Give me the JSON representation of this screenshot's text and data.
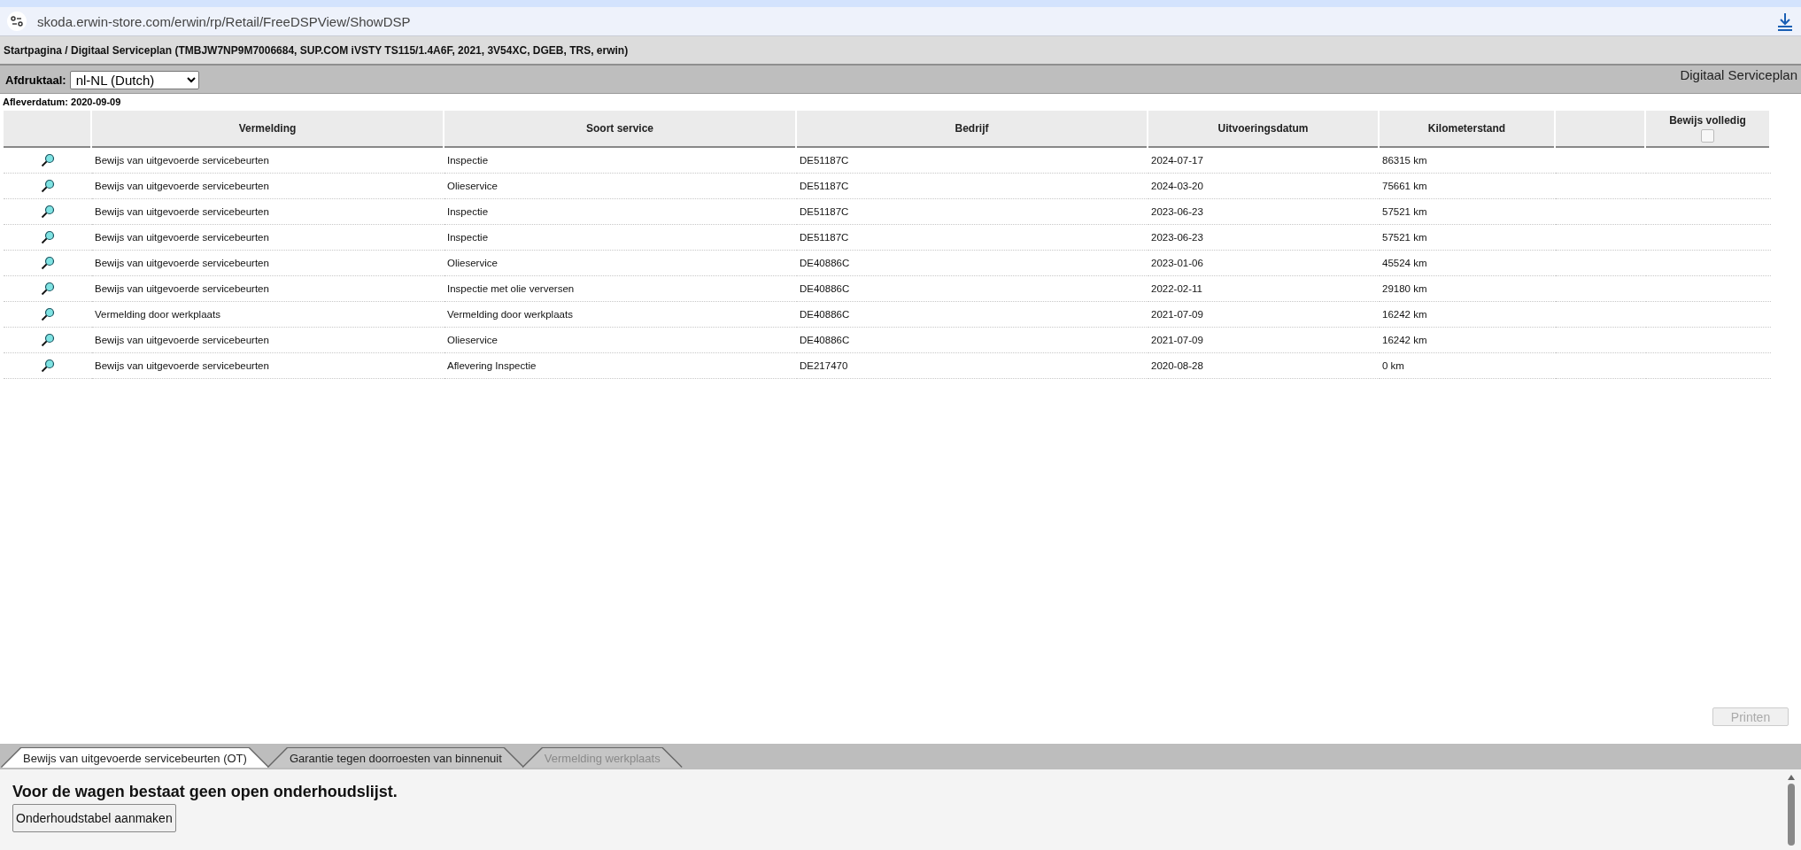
{
  "browser": {
    "url": "skoda.erwin-store.com/erwin/rp/Retail/FreeDSPView/ShowDSP"
  },
  "breadcrumb": "Startpagina / Digitaal Serviceplan (TMBJW7NP9M7006684, SUP.COM iVSTY TS115/1.4A6F, 2021, 3V54XC, DGEB, TRS, erwin)",
  "toolbar": {
    "language_label": "Afdruktaal:",
    "language_value": "nl-NL (Dutch)",
    "title": "Digitaal Serviceplan"
  },
  "delivery_date": "Afleverdatum: 2020-09-09",
  "table": {
    "columns": [
      "Vermelding",
      "Soort service",
      "Bedrijf",
      "Uitvoeringsdatum",
      "Kilometerstand",
      "Bewijs volledig"
    ],
    "complete_checked": false,
    "rows": [
      [
        "Bewijs van uitgevoerde servicebeurten",
        "Inspectie",
        "DE51187C",
        "2024-07-17",
        "86315 km"
      ],
      [
        "Bewijs van uitgevoerde servicebeurten",
        "Olieservice",
        "DE51187C",
        "2024-03-20",
        "75661 km"
      ],
      [
        "Bewijs van uitgevoerde servicebeurten",
        "Inspectie",
        "DE51187C",
        "2023-06-23",
        "57521 km"
      ],
      [
        "Bewijs van uitgevoerde servicebeurten",
        "Inspectie",
        "DE51187C",
        "2023-06-23",
        "57521 km"
      ],
      [
        "Bewijs van uitgevoerde servicebeurten",
        "Olieservice",
        "DE40886C",
        "2023-01-06",
        "45524 km"
      ],
      [
        "Bewijs van uitgevoerde servicebeurten",
        "Inspectie met olie verversen",
        "DE40886C",
        "2022-02-11",
        "29180 km"
      ],
      [
        "Vermelding door werkplaats",
        "Vermelding door werkplaats",
        "DE40886C",
        "2021-07-09",
        "16242 km"
      ],
      [
        "Bewijs van uitgevoerde servicebeurten",
        "Olieservice",
        "DE40886C",
        "2021-07-09",
        "16242 km"
      ],
      [
        "Bewijs van uitgevoerde servicebeurten",
        "Aflevering Inspectie",
        "DE217470",
        "2020-08-28",
        "0 km"
      ]
    ]
  },
  "print_button": {
    "label": "Printen",
    "disabled": true
  },
  "tabs": [
    {
      "label": "Bewijs van uitgevoerde servicebeurten (OT)",
      "selected": true,
      "disabled": false
    },
    {
      "label": "Garantie tegen doorroesten van binnenuit",
      "selected": false,
      "disabled": false
    },
    {
      "label": "Vermelding werkplaats",
      "selected": false,
      "disabled": true
    }
  ],
  "panel": {
    "message": "Voor de wagen bestaat geen open onderhoudslijst.",
    "button": "Onderhoudstabel aanmaken"
  }
}
